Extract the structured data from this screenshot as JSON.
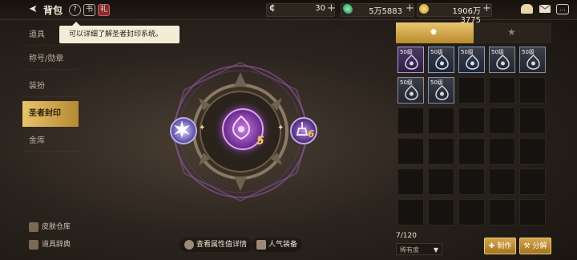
{
  "header": {
    "back_glyph": "➤",
    "title": "背包",
    "help_glyph": "?",
    "codex_glyph": "书",
    "gift_glyph": "礼"
  },
  "currency": {
    "c1": {
      "icon": "c-currency-icon",
      "value": "30"
    },
    "c2": {
      "icon": "green-gem-icon",
      "value": "5万5883"
    },
    "c3": {
      "icon": "gold-coin-icon",
      "value": "1906万3775"
    }
  },
  "tooltip": {
    "text": "可以详细了解圣者封印系统。"
  },
  "sidebar": {
    "items": [
      {
        "label": "道具"
      },
      {
        "label": "称号/勋章"
      },
      {
        "label": "装扮"
      },
      {
        "label": "圣者封印"
      },
      {
        "label": "金库"
      }
    ]
  },
  "bottom_links": {
    "wardrobe": "皮肤仓库",
    "dictionary": "道具辞典"
  },
  "seal": {
    "center_level": "5",
    "right_level": "6"
  },
  "buttons": {
    "details": "查看属性值详情",
    "popular": "人气装备",
    "craft": "制作",
    "disassemble": "分解"
  },
  "inventory": {
    "tabs": [
      {
        "icon": "sun-icon"
      },
      {
        "icon": "star-icon"
      }
    ],
    "items": [
      {
        "level": "50级",
        "rarity": "purple"
      },
      {
        "level": "50级",
        "rarity": "blue"
      },
      {
        "level": "50级",
        "rarity": "blue"
      },
      {
        "level": "50级",
        "rarity": "gray"
      },
      {
        "level": "50级",
        "rarity": "gray"
      },
      {
        "level": "50级",
        "rarity": "gray"
      },
      {
        "level": "50级",
        "rarity": "gray"
      }
    ],
    "count": "7/120",
    "sort_label": "稀有度"
  },
  "colors": {
    "accent_gold": "#d7a54a",
    "seal_purple": "#b45ad8",
    "active_tab": "#e8c36a"
  }
}
